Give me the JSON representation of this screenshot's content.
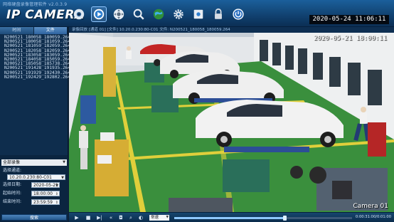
{
  "app": {
    "caption": "网络硬盘录像管理软件 v2.0.3.9",
    "title": "IP CAMERA",
    "clock": "2020-05-24  11:06:11"
  },
  "toolbar": {
    "items": [
      {
        "name": "live-view",
        "icon": "globe-camera-icon"
      },
      {
        "name": "playback",
        "icon": "playback-icon",
        "active": true
      },
      {
        "name": "ptz",
        "icon": "ptz-control-icon"
      },
      {
        "name": "search",
        "icon": "search-icon"
      },
      {
        "name": "network",
        "icon": "network-globe-icon"
      },
      {
        "name": "settings",
        "icon": "gear-icon"
      },
      {
        "name": "device-manage",
        "icon": "device-icon"
      },
      {
        "name": "lock",
        "icon": "lock-icon"
      },
      {
        "name": "power",
        "icon": "power-icon"
      }
    ]
  },
  "sidebar": {
    "tabs": [
      "时间",
      "文件"
    ],
    "files": [
      "N200521_180058_180059.264",
      "N200521_180058_181059.264",
      "N200521_181059_182059.264",
      "N200521_182058_182059.264",
      "N200521_183058_183059.264",
      "N200521_184058_185059.264",
      "N200521_185058_185738.264",
      "N200521_191428_191935.264",
      "N200521_191929_192430.264",
      "N200521_192429_192802.264"
    ],
    "query": {
      "channel_type": "全部录像",
      "device_label": "选择通道:",
      "device_value": "10.20.0.230:80-C01",
      "date_label": "选择日期:",
      "date_value": "2020-05-21",
      "start_label": "起始时间:",
      "start_value": "18:00:00",
      "end_label": "结束时间:",
      "end_value": "23:59:59",
      "search_label": "搜索"
    }
  },
  "player": {
    "header": "录像回放 [通道 01] [文件] 10.20.0.230:80-C01 文件: N200521_180058_180059.264",
    "osd_time": "2020-05-21  18:00:11",
    "osd_label": "Camera 01",
    "speed": "常速",
    "progress": 0.62,
    "progress_text": "0:00:31:00/0:01:00"
  },
  "colors": {
    "floor": "#3a8f3d",
    "stripe": "#e0cf3b",
    "brand_blue": "#1b5f9b"
  }
}
